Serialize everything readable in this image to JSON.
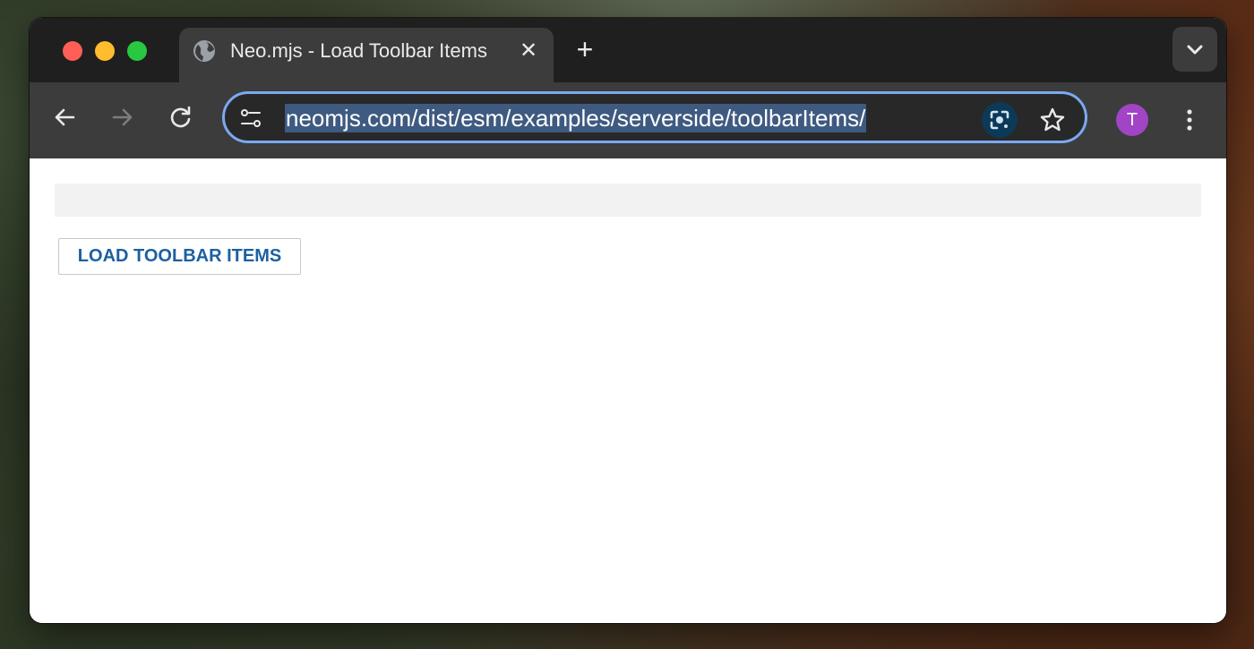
{
  "browser": {
    "tab": {
      "title": "Neo.mjs - Load Toolbar Items",
      "close_glyph": "✕",
      "icon": "globe-icon"
    },
    "new_tab_glyph": "+",
    "address_bar": {
      "url": "neomjs.com/dist/esm/examples/serverside/toolbarItems/",
      "icons": [
        "site-info-icon",
        "google-lens-icon",
        "bookmark-star-icon"
      ]
    },
    "profile": {
      "initial": "T",
      "color": "#a144c5"
    },
    "accent_color": "#7aa9f0"
  },
  "page": {
    "button": {
      "label": "LOAD TOOLBAR ITEMS",
      "color": "#1c60a0"
    }
  }
}
